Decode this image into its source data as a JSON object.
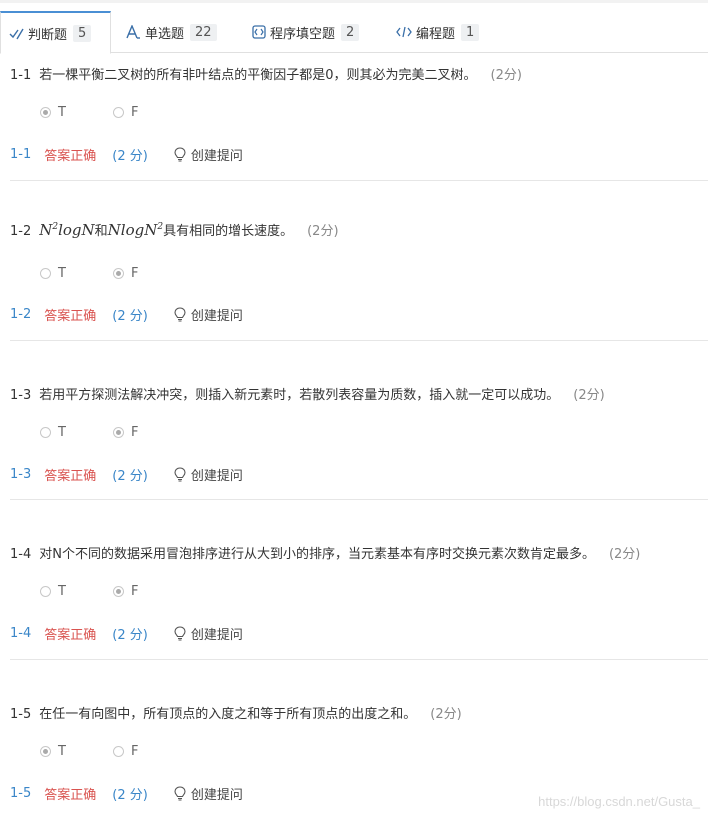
{
  "tabs": [
    {
      "label": "判断题",
      "count": "5",
      "icon": "check-pencil-icon"
    },
    {
      "label": "单选题",
      "count": "22",
      "icon": "letter-a-icon"
    },
    {
      "label": "程序填空题",
      "count": "2",
      "icon": "code-box-icon"
    },
    {
      "label": "编程题",
      "count": "1",
      "icon": "code-brackets-icon"
    }
  ],
  "questions": [
    {
      "num": "1-1",
      "text": "若一棵平衡二叉树的所有非叶结点的平衡因子都是0，则其必为完美二叉树。",
      "score": "(2分)",
      "selected": "T"
    },
    {
      "num": "1-2",
      "text_a": "N",
      "sup_a": "2",
      "text_b": "logN",
      "mid": "和",
      "text_c": "NlogN",
      "sup_c": "2",
      "tail": "具有相同的增长速度。",
      "score": "(2分)",
      "selected": "F"
    },
    {
      "num": "1-3",
      "text": "若用平方探测法解决冲突，则插入新元素时，若散列表容量为质数，插入就一定可以成功。",
      "score": "(2分)",
      "selected": "F"
    },
    {
      "num": "1-4",
      "text": "对N个不同的数据采用冒泡排序进行从大到小的排序，当元素基本有序时交换元素次数肯定最多。",
      "score": "(2分)",
      "selected": "F"
    },
    {
      "num": "1-5",
      "text": "在任一有向图中，所有顶点的入度之和等于所有顶点的出度之和。",
      "score": "(2分)",
      "selected": "T"
    }
  ],
  "option_labels": {
    "t": "T",
    "f": "F"
  },
  "result": {
    "status": "答案正确",
    "points": "(2 分)",
    "hint_label": "创建提问"
  },
  "watermark": "https://blog.csdn.net/Gusta_",
  "colors": {
    "accent": "#3a86c8",
    "correct": "#d9534f"
  }
}
